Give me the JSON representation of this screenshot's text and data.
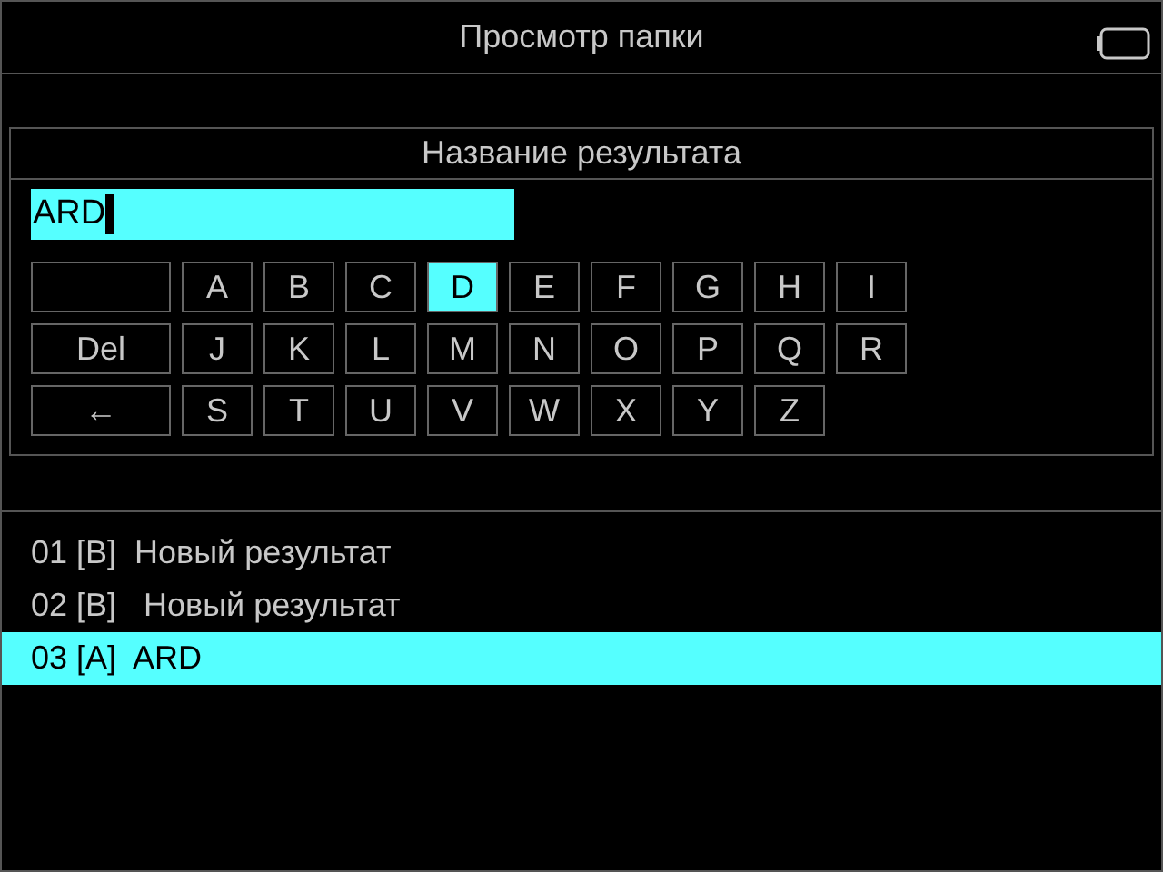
{
  "header": {
    "title": "Просмотр папки"
  },
  "dialog": {
    "title": "Название результата",
    "input": {
      "value": "ARD"
    },
    "keys": [
      [
        {
          "kind": "wide",
          "selected": false
        },
        {
          "kind": "letter",
          "label": "A",
          "selected": false
        },
        {
          "kind": "letter",
          "label": "B",
          "selected": false
        },
        {
          "kind": "letter",
          "label": "C",
          "selected": false
        },
        {
          "kind": "letter",
          "label": "D",
          "selected": true
        },
        {
          "kind": "letter",
          "label": "E",
          "selected": false
        },
        {
          "kind": "letter",
          "label": "F",
          "selected": false
        },
        {
          "kind": "letter",
          "label": "G",
          "selected": false
        },
        {
          "kind": "letter",
          "label": "H",
          "selected": false
        },
        {
          "kind": "letter",
          "label": "I",
          "selected": false
        }
      ],
      [
        {
          "kind": "wide",
          "label": "Del",
          "selected": false
        },
        {
          "kind": "letter",
          "label": "J",
          "selected": false
        },
        {
          "kind": "letter",
          "label": "K",
          "selected": false
        },
        {
          "kind": "letter",
          "label": "L",
          "selected": false
        },
        {
          "kind": "letter",
          "label": "M",
          "selected": false
        },
        {
          "kind": "letter",
          "label": "N",
          "selected": false
        },
        {
          "kind": "letter",
          "label": "O",
          "selected": false
        },
        {
          "kind": "letter",
          "label": "P",
          "selected": false
        },
        {
          "kind": "letter",
          "label": "Q",
          "selected": false
        },
        {
          "kind": "letter",
          "label": "R",
          "selected": false
        }
      ],
      [
        {
          "kind": "wide",
          "label": "←",
          "selected": false
        },
        {
          "kind": "letter",
          "label": "S",
          "selected": false
        },
        {
          "kind": "letter",
          "label": "T",
          "selected": false
        },
        {
          "kind": "letter",
          "label": "U",
          "selected": false
        },
        {
          "kind": "letter",
          "label": "V",
          "selected": false
        },
        {
          "kind": "letter",
          "label": "W",
          "selected": false
        },
        {
          "kind": "letter",
          "label": "X",
          "selected": false
        },
        {
          "kind": "letter",
          "label": "Y",
          "selected": false
        },
        {
          "kind": "letter",
          "label": "Z",
          "selected": false
        }
      ]
    ]
  },
  "results": [
    {
      "index": "01",
      "tag": "[B]",
      "name": "Новый результат",
      "selected": false
    },
    {
      "index": "02",
      "tag": "[B]",
      "name": " Новый результат",
      "selected": false
    },
    {
      "index": "03",
      "tag": "[A]",
      "name": "ARD",
      "selected": true
    }
  ]
}
